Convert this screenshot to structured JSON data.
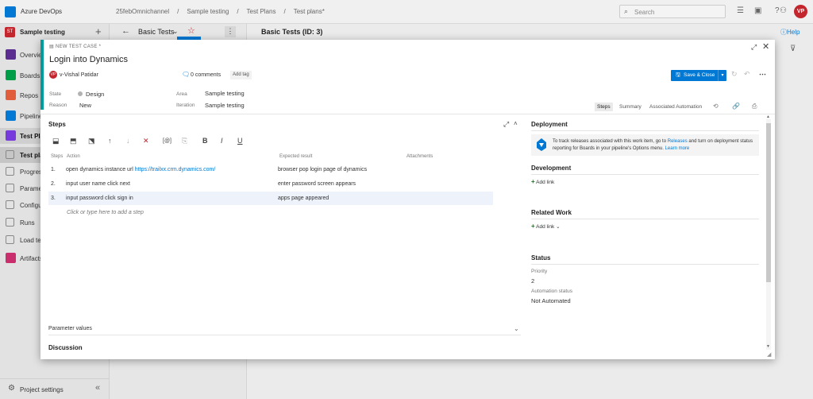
{
  "topbar": {
    "brand": "Azure DevOps",
    "breadcrumbs": [
      "25febOmnichannel",
      "/",
      "Sample testing",
      "/",
      "Test Plans",
      "/",
      "Test plans*"
    ],
    "search_placeholder": "Search",
    "avatar": "VP"
  },
  "leftnav": {
    "project_badge": "ST",
    "project_name": "Sample testing",
    "items": [
      {
        "label": "Overview",
        "color": "#5c2d91"
      },
      {
        "label": "Boards",
        "color": "#009e49"
      },
      {
        "label": "Repos",
        "color": "#e05e3c"
      },
      {
        "label": "Pipelines",
        "color": "#0078d4"
      },
      {
        "label": "Test Plans",
        "color": "#773adc"
      }
    ],
    "subitems": [
      "Test plans",
      "Progress report",
      "Parameters",
      "Configurations",
      "Runs",
      "Load test"
    ],
    "artifacts": {
      "label": "Artifacts",
      "color": "#cb2e6d"
    },
    "settings": "Project settings"
  },
  "suitepane": {
    "title": "Basic Tests"
  },
  "mainpane": {
    "title": "Basic Tests (ID: 3)",
    "help": "Help"
  },
  "dialog": {
    "kind": "NEW TEST CASE *",
    "title": "Login into Dynamics",
    "owner_badge": "VP",
    "owner": "v-Vishal Patidar",
    "comments": "0 comments",
    "add_tag": "Add tag",
    "save_label": "Save & Close",
    "fields": {
      "state_label": "State",
      "state_value": "Design",
      "reason_label": "Reason",
      "reason_value": "New",
      "area_label": "Area",
      "area_value": "Sample testing",
      "iteration_label": "Iteration",
      "iteration_value": "Sample testing"
    },
    "tabs": [
      "Steps",
      "Summary",
      "Associated Automation"
    ],
    "steps": {
      "title": "Steps",
      "col_steps": "Steps",
      "col_action": "Action",
      "col_expected": "Expected result",
      "col_attachments": "Attachments",
      "rows": [
        {
          "num": "1.",
          "action": "open dynamics instance url ",
          "action_link": "https://trailxx.crm.dynamics.com/",
          "expected": "browser pop login page of dynamics"
        },
        {
          "num": "2.",
          "action": "input user name click next",
          "action_link": "",
          "expected": "enter password screen appears"
        },
        {
          "num": "3.",
          "action": "input password click sign in",
          "action_link": "",
          "expected": "apps page appeared"
        }
      ],
      "add_step": "Click or type here to add a step"
    },
    "parameter_values": "Parameter values",
    "discussion": "Discussion",
    "right": {
      "deployment_title": "Deployment",
      "deployment_text_1": "To track releases associated with this work item, go to ",
      "deployment_link": "Releases",
      "deployment_text_2": " and turn on deployment status reporting for Boards in your pipeline's Options menu. ",
      "deployment_learn": "Learn more",
      "development_title": "Development",
      "add_link": "Add link",
      "related_title": "Related Work",
      "related_add_link": "Add link",
      "status_title": "Status",
      "priority_label": "Priority",
      "priority_value": "2",
      "automation_label": "Automation status",
      "automation_value": "Not Automated"
    }
  }
}
